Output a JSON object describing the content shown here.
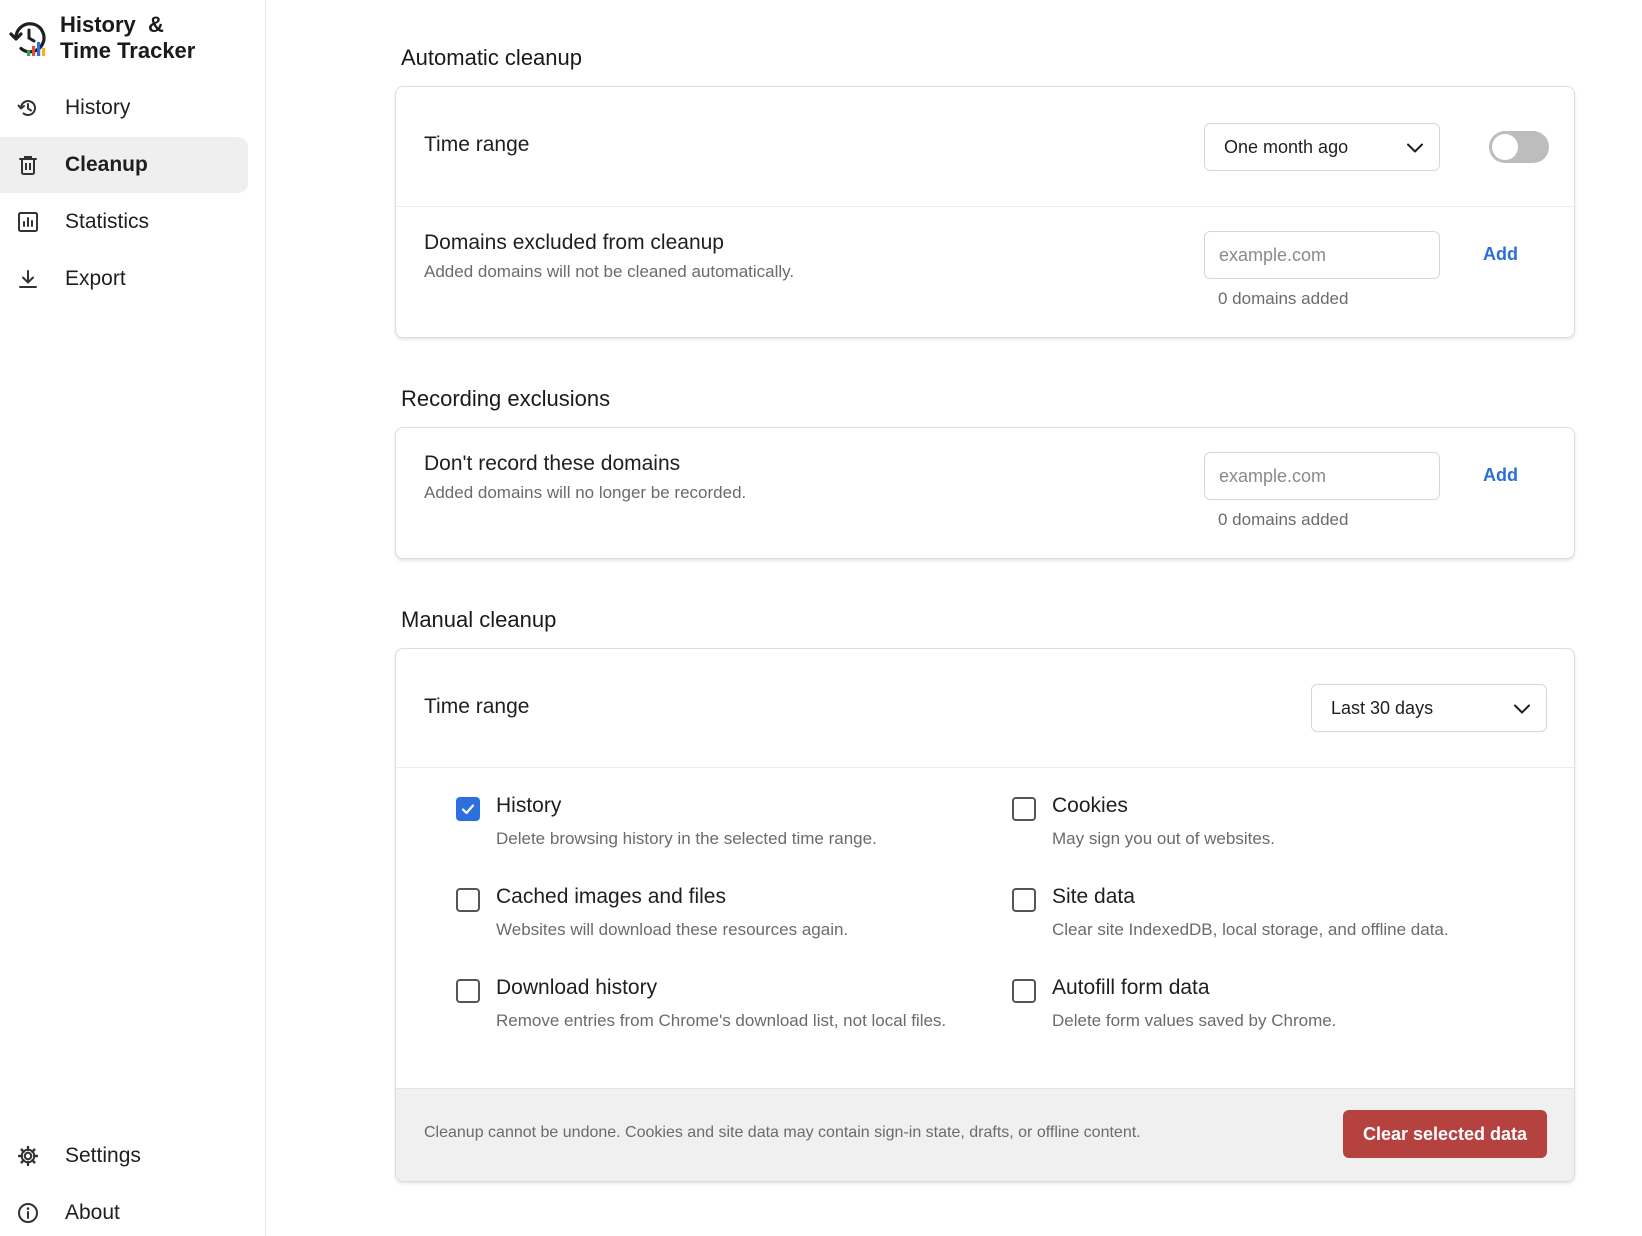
{
  "app": {
    "title_line1": "History  &",
    "title_line2": "Time Tracker",
    "logo_icon": "history-chart-logo"
  },
  "sidebar": {
    "items": [
      {
        "label": "History",
        "icon": "history-icon",
        "active": false
      },
      {
        "label": "Cleanup",
        "icon": "trash-icon",
        "active": true
      },
      {
        "label": "Statistics",
        "icon": "bar-chart-icon",
        "active": false
      },
      {
        "label": "Export",
        "icon": "download-icon",
        "active": false
      }
    ],
    "bottom_items": [
      {
        "label": "Settings",
        "icon": "gear-icon"
      },
      {
        "label": "About",
        "icon": "info-icon"
      }
    ]
  },
  "automatic_cleanup": {
    "title": "Automatic cleanup",
    "time_range_label": "Time range",
    "time_range_value": "One month ago",
    "enabled": false,
    "excluded_label": "Domains excluded from cleanup",
    "excluded_desc": "Added domains will not be cleaned automatically.",
    "excluded_placeholder": "example.com",
    "add_label": "Add",
    "excluded_count": "0 domains added"
  },
  "recording_exclusions": {
    "title": "Recording exclusions",
    "label": "Don't record these domains",
    "desc": "Added domains will no longer be recorded.",
    "placeholder": "example.com",
    "add_label": "Add",
    "count": "0 domains added"
  },
  "manual_cleanup": {
    "title": "Manual cleanup",
    "time_range_label": "Time range",
    "time_range_value": "Last 30 days",
    "options": [
      {
        "label": "History",
        "desc": "Delete browsing history in the selected time range.",
        "checked": true
      },
      {
        "label": "Cookies",
        "desc": "May sign you out of websites.",
        "checked": false
      },
      {
        "label": "Cached images and files",
        "desc": "Websites will download these resources again.",
        "checked": false
      },
      {
        "label": "Site data",
        "desc": "Clear site IndexedDB, local storage, and offline data.",
        "checked": false
      },
      {
        "label": "Download history",
        "desc": "Remove entries from Chrome's download list, not local files.",
        "checked": false
      },
      {
        "label": "Autofill form data",
        "desc": "Delete form values saved by Chrome.",
        "checked": false
      }
    ],
    "footer_note": "Cleanup cannot be undone. Cookies and site data may contain sign-in state, drafts, or offline content.",
    "clear_button": "Clear selected data"
  },
  "colors": {
    "accent": "#2e6fe0",
    "link": "#2b6fd6",
    "danger": "#b5423f",
    "active_nav_bg": "#efefef"
  }
}
